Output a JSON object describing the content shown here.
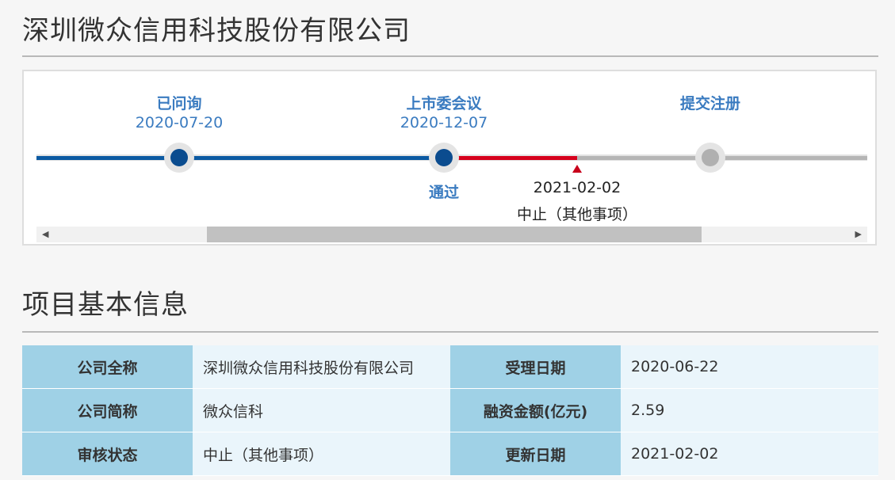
{
  "header": {
    "title": "深圳微众信用科技股份有限公司"
  },
  "timeline": {
    "steps": [
      {
        "label": "已问询",
        "date": "2020-07-20",
        "status": "done"
      },
      {
        "label": "上市委会议",
        "date": "2020-12-07",
        "result": "通过",
        "status": "done"
      },
      {
        "label": "提交注册",
        "date": "",
        "status": "pending"
      }
    ],
    "current_marker": {
      "date": "2021-02-02",
      "status": "中止（其他事项）"
    },
    "colors": {
      "completed": "#0b5aa2",
      "current": "#d6001c",
      "pending": "#b5b5b5"
    }
  },
  "section": {
    "title": "项目基本信息"
  },
  "info_table": {
    "rows": [
      {
        "k1": "公司全称",
        "v1": "深圳微众信用科技股份有限公司",
        "k2": "受理日期",
        "v2": "2020-06-22"
      },
      {
        "k1": "公司简称",
        "v1": "微众信科",
        "k2": "融资金额(亿元)",
        "v2": "2.59"
      },
      {
        "k1": "审核状态",
        "v1": "中止（其他事项）",
        "k2": "更新日期",
        "v2": "2021-02-02"
      }
    ]
  },
  "scrollbar": {
    "left_icon": "arrow-left-icon",
    "right_icon": "arrow-right-icon"
  }
}
